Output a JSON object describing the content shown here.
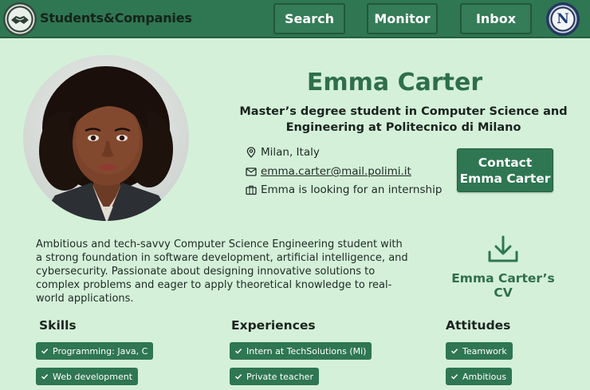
{
  "header": {
    "brand": "Students&Companies",
    "nav": {
      "search": "Search",
      "monitor": "Monitor",
      "inbox": "Inbox"
    },
    "user_logo_letter": "N",
    "colors": {
      "bar": "#2f7652",
      "text": "#ffffff"
    }
  },
  "profile": {
    "name": "Emma Carter",
    "subtitle": "Master’s degree student in Computer Science and Engineering at Politecnico di Milano",
    "location": "Milan, Italy",
    "email": "emma.carter@mail.polimi.it",
    "status": "Emma is looking for an internship",
    "contact_button": "Contact Emma Carter",
    "bio": "Ambitious and tech-savvy Computer Science Engineering student with a strong foundation in software development, artificial intelligence, and cybersecurity. Passionate about designing innovative solutions to complex problems and eager to apply theoretical knowledge to real-world applications.",
    "cv_label": "Emma Carter’s CV"
  },
  "sections": {
    "skills": {
      "title": "Skills",
      "items": [
        "Programming: Java, C",
        "Web development"
      ]
    },
    "experiences": {
      "title": "Experiences",
      "items": [
        "Intern at TechSolutions (Mi)",
        "Private teacher"
      ]
    },
    "attitudes": {
      "title": "Attitudes",
      "items": [
        "Teamwork",
        "Ambitious"
      ]
    }
  },
  "icons": {
    "logo": "handshake-logo-icon",
    "location": "map-pin-icon",
    "email": "envelope-icon",
    "status": "briefcase-icon",
    "cv": "download-icon",
    "chip": "check-icon"
  },
  "theme": {
    "accent": "#2f7652",
    "background": "#d4f0d9",
    "name_color": "#2f6e4c"
  }
}
